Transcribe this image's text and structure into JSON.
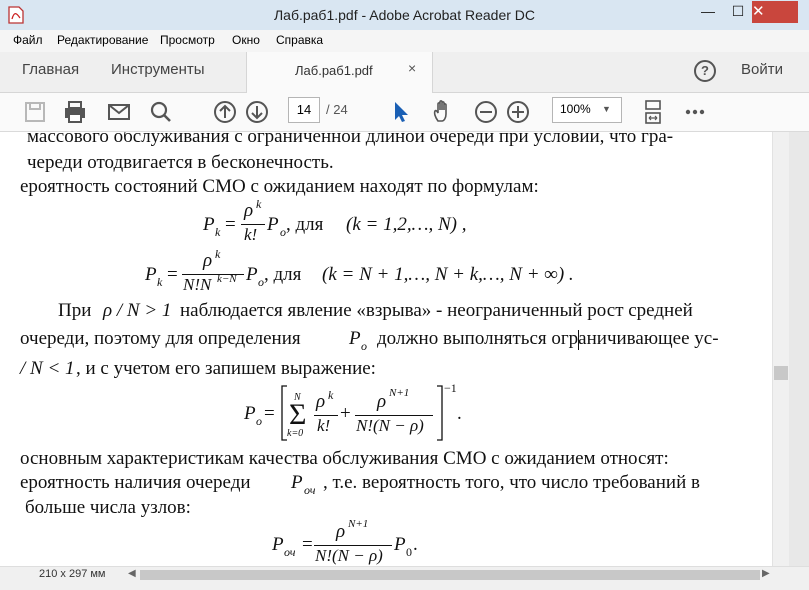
{
  "window": {
    "title": "Лаб.раб1.pdf - Adobe Acrobat Reader DC",
    "minimize": "—",
    "maximize": "☐",
    "close": "✕"
  },
  "menu": [
    "Файл",
    "Редактирование",
    "Просмотр",
    "Окно",
    "Справка"
  ],
  "tabs": {
    "home": "Главная",
    "tools": "Инструменты",
    "document": "Лаб.раб1.pdf",
    "close": "×",
    "help": "?",
    "signin": "Войти"
  },
  "toolbar": {
    "page_current": "14",
    "page_total": "/ 24",
    "zoom": "100%"
  },
  "status": {
    "page_size": "210 x 297 мм"
  },
  "doc": {
    "l1": "массового обслуживания с ограниченной длиной очереди при условии, что гра-",
    "l2": "череди отодвигается в бесконечность.",
    "l3": "ероятность состояний СМО с ожиданием находят по формулам:",
    "f1_P": "P",
    "f1_k": "k",
    "f1_eq": "=",
    "f1_rho": "ρ",
    "f1_kexp": "k",
    "f1_den": "k!",
    "f1_Po": "P",
    "f1_o": "o",
    "f1_for": ", для",
    "f1_cond": "(k = 1,2,…, N) ,",
    "f2_P": "P",
    "f2_k": "k",
    "f2_eq": "=",
    "f2_rho": "ρ",
    "f2_kexp": "k",
    "f2_den": "N!N",
    "f2_denexp": "k−N",
    "f2_Po": "P",
    "f2_o": "o",
    "f2_for": ", для",
    "f2_cond": "(k = N + 1,…, N + k,…, N + ∞) .",
    "l4a": "При",
    "l4m": "ρ / N > 1",
    "l4b": "наблюдается явление «взрыва» - неограниченный рост средней",
    "l5a": "очереди, поэтому для определения",
    "l5m": "P",
    "l5o": "o",
    "l5b": "должно выполняться ограничивающее ус-",
    "l6m": "/ N < 1",
    "l6b": ", и с учетом его запишем выражение:",
    "f3_P": "P",
    "f3_o": "o",
    "f3_eq": "=",
    "f3_sum": "Σ",
    "f3_top": "N",
    "f3_bot": "k=0",
    "f3_rho1": "ρ",
    "f3_kexp": "k",
    "f3_den1": "k!",
    "f3_plus": "+",
    "f3_rho2": "ρ",
    "f3_exp2": "N+1",
    "f3_den2": "N!(N − ρ)",
    "f3_pow": "−1",
    "f3_dot": ".",
    "l7": "основным характеристикам качества обслуживания СМО с ожиданием относят:",
    "l8a": "ероятность наличия очереди",
    "l8m": "P",
    "l8s": "оч",
    "l8b": ", т.е. вероятность того, что число требований в",
    "l9": "больше числа узлов:",
    "f4_P": "P",
    "f4_s": "оч",
    "f4_eq": "=",
    "f4_rho": "ρ",
    "f4_exp": "N+1",
    "f4_den": "N!(N − ρ)",
    "f4_P0": "P",
    "f4_0": "0",
    "f4_dot": "."
  }
}
